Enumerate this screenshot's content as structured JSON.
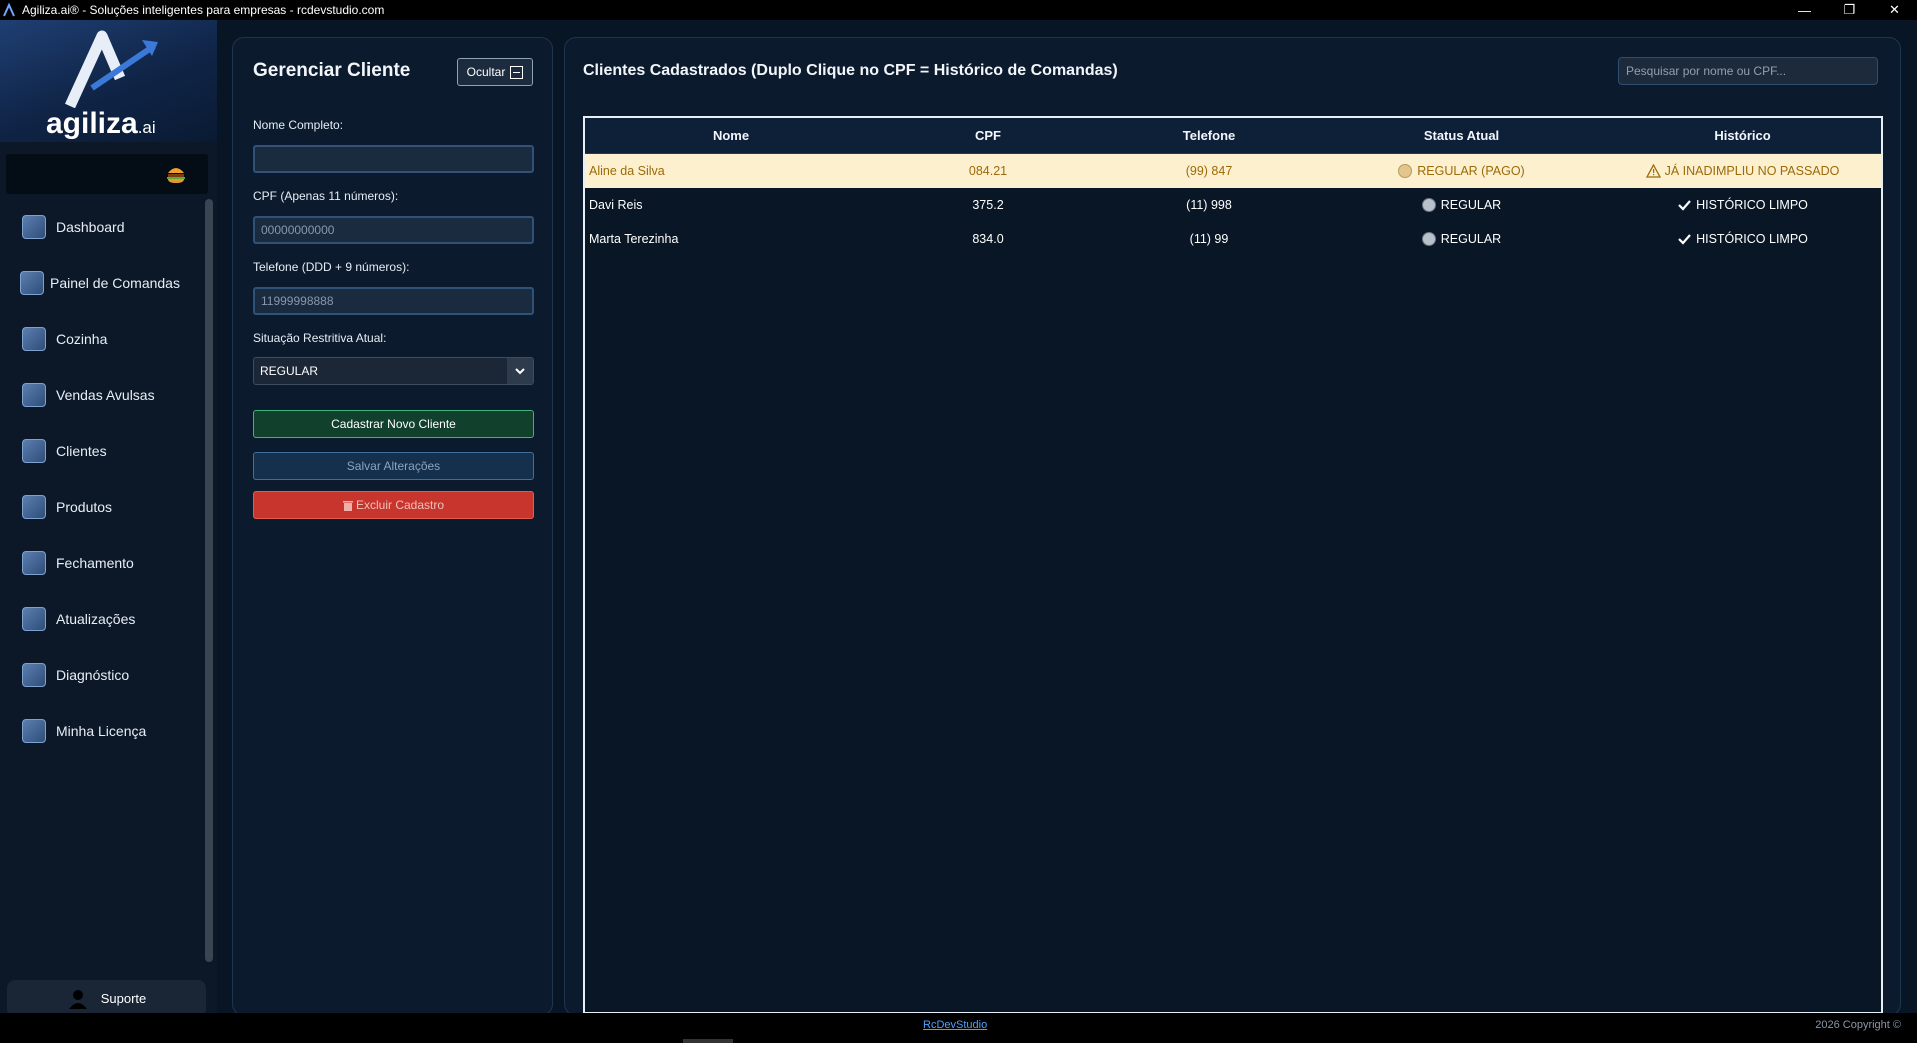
{
  "window": {
    "title": "Agiliza.ai® - Soluções inteligentes para empresas - rcdevstudio.com",
    "minimize": "—",
    "restore": "❐",
    "close": "✕"
  },
  "logo": {
    "brand": "agiliza",
    "suffix": ".ai"
  },
  "sidebar": {
    "items": [
      {
        "label": "Dashboard",
        "icon": "dashboard-icon"
      },
      {
        "label": "Painel de Comandas",
        "icon": "orders-panel-icon"
      },
      {
        "label": "Cozinha",
        "icon": "kitchen-icon"
      },
      {
        "label": "Vendas Avulsas",
        "icon": "sales-icon"
      },
      {
        "label": "Clientes",
        "icon": "clients-icon"
      },
      {
        "label": "Produtos",
        "icon": "products-icon"
      },
      {
        "label": "Fechamento",
        "icon": "closing-icon"
      },
      {
        "label": "Atualizações",
        "icon": "updates-icon"
      },
      {
        "label": "Diagnóstico",
        "icon": "diagnostics-icon"
      },
      {
        "label": "Minha Licença",
        "icon": "license-icon"
      }
    ],
    "support_label": "Suporte"
  },
  "form": {
    "title": "Gerenciar Cliente",
    "hide_label": "Ocultar",
    "name_label": "Nome Completo:",
    "name_value": "",
    "cpf_label": "CPF (Apenas 11 números):",
    "cpf_placeholder": "00000000000",
    "phone_label": "Telefone (DDD + 9 números):",
    "phone_placeholder": "11999998888",
    "status_label": "Situação Restritiva Atual:",
    "status_value": "REGULAR",
    "btn_new": "Cadastrar Novo Cliente",
    "btn_save": "Salvar Alterações",
    "btn_delete": "Excluir Cadastro"
  },
  "main": {
    "title": "Clientes Cadastrados (Duplo Clique no CPF = Histórico de Comandas)",
    "search_placeholder": "Pesquisar por nome ou CPF...",
    "columns": {
      "name": "Nome",
      "cpf": "CPF",
      "phone": "Telefone",
      "status": "Status Atual",
      "history": "Histórico"
    },
    "rows": [
      {
        "name": "Aline da Silva",
        "cpf": "084.21",
        "phone": "(99) 847",
        "status": "REGULAR (PAGO)",
        "history": "JÁ INADIMPLIU NO PASSADO"
      },
      {
        "name": "Davi Reis",
        "cpf": "375.2",
        "phone": "(11) 998",
        "status": "REGULAR",
        "history": "HISTÓRICO LIMPO"
      },
      {
        "name": "Marta Terezinha",
        "cpf": "834.0",
        "phone": "(11) 99",
        "status": "REGULAR",
        "history": "HISTÓRICO LIMPO"
      }
    ]
  },
  "footer": {
    "link": "RcDevStudio",
    "copyright": "2026 Copyright ©"
  }
}
